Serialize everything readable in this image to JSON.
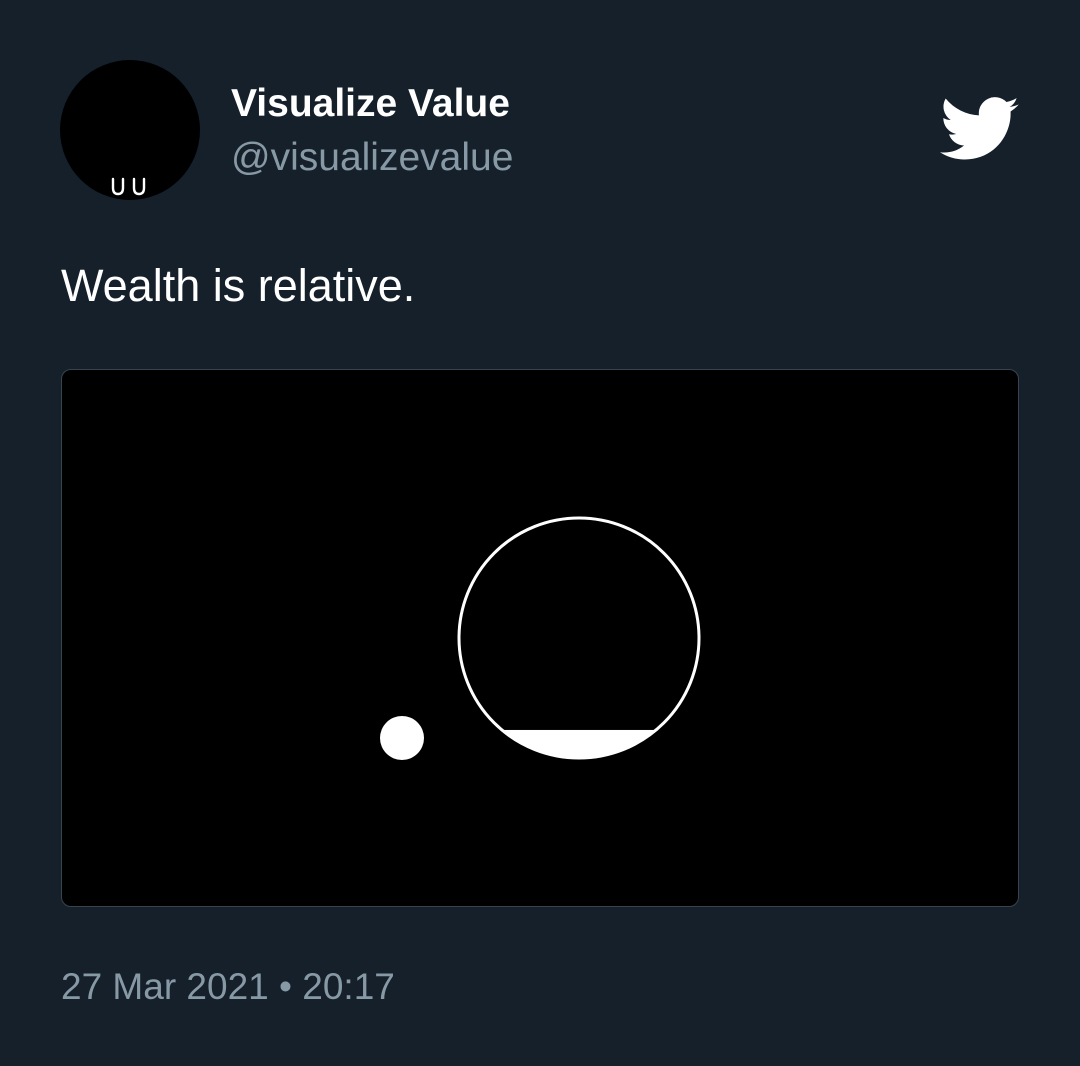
{
  "author": {
    "avatar_text": "VV",
    "display_name": "Visualize Value",
    "handle": "@visualizevalue"
  },
  "platform_icon": "twitter-bird-icon",
  "tweet": {
    "text": "Wealth is relative."
  },
  "media": {
    "description_icon": "relative-wealth-illustration",
    "big_circle_fill_fraction": 0.12
  },
  "meta": {
    "date": "27 Mar 2021",
    "separator": "•",
    "time": "20:17"
  },
  "colors": {
    "background": "#15202b",
    "primary_text": "#ffffff",
    "secondary_text": "#8899a6",
    "border": "#38444d",
    "media_background": "#000000"
  }
}
